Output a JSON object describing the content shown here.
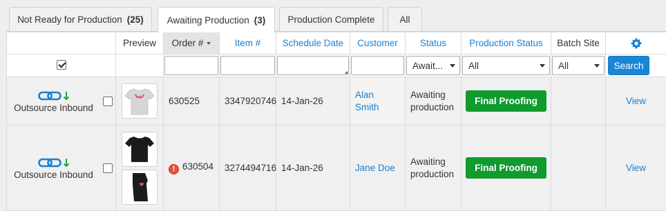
{
  "tabs": [
    {
      "label": "Not Ready for Production",
      "count": "(25)"
    },
    {
      "label": "Awaiting Production",
      "count": "(3)"
    },
    {
      "label": "Production Complete",
      "count": ""
    },
    {
      "label": "All",
      "count": ""
    }
  ],
  "headers": {
    "preview": "Preview",
    "order": "Order #",
    "item": "Item #",
    "schedule_date": "Schedule Date",
    "customer": "Customer",
    "status": "Status",
    "production_status": "Production Status",
    "batch_site": "Batch Site"
  },
  "filters": {
    "status_selected": "Await...",
    "production_status_selected": "All",
    "batch_site_selected": "All",
    "search_label": "Search"
  },
  "rows": [
    {
      "source_label": "Outsource Inbound",
      "order": "630525",
      "item": "3347920746",
      "schedule_date": "14-Jan-26",
      "customer": "Alan Smith",
      "status": "Awaiting production",
      "production_status": "Final Proofing",
      "action": "View"
    },
    {
      "source_label": "Outsource Inbound",
      "order": "630504",
      "item": "3274494716",
      "schedule_date": "14-Jan-26",
      "customer": "Jane Doe",
      "status": "Awaiting production",
      "production_status": "Final Proofing",
      "action": "View"
    }
  ],
  "alert_glyph": "!",
  "colors": {
    "link": "#1a7fd0",
    "final_proofing_button": "#0f9b2e",
    "search_button": "#1a86d6",
    "sorted_header": "#e4e4e4"
  },
  "icons": [
    "link-chain-icon",
    "arrow-down-icon",
    "gear-icon",
    "alert-icon",
    "tshirt-icon"
  ]
}
